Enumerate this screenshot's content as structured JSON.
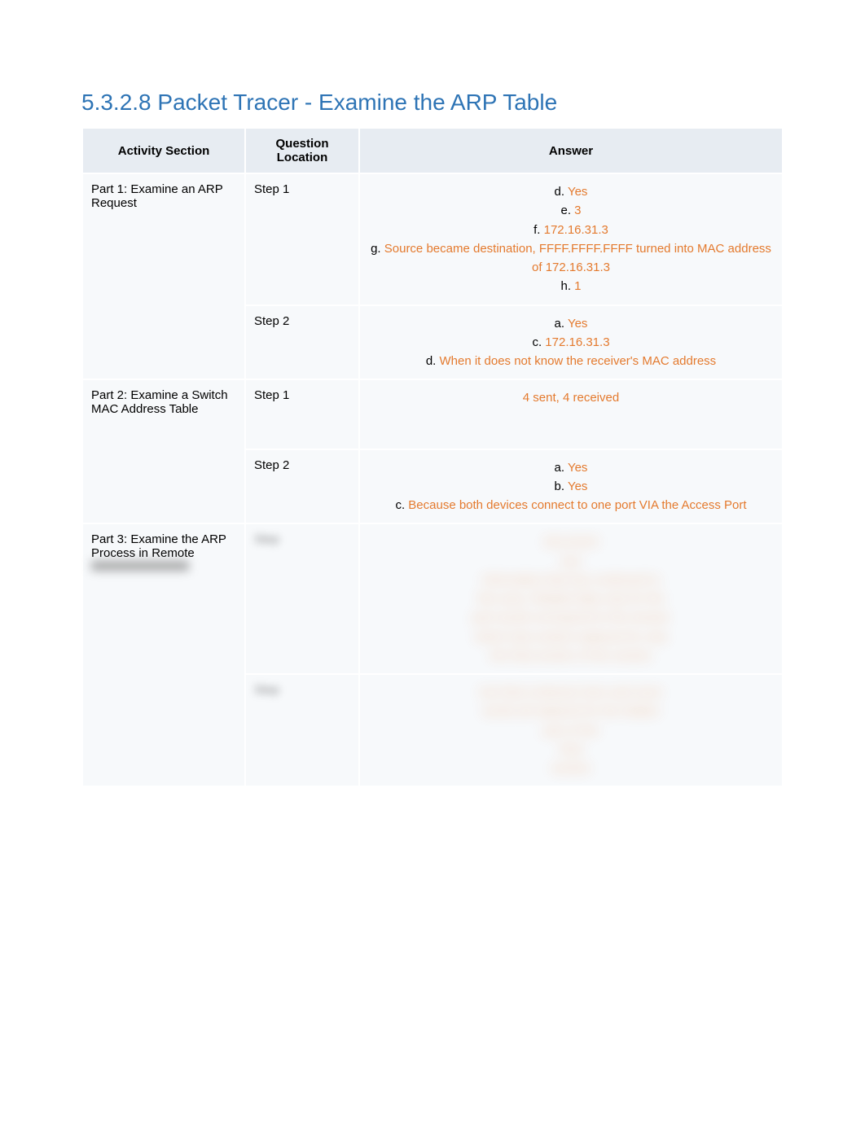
{
  "title": "5.3.2.8 Packet Tracer - Examine the ARP Table",
  "headers": {
    "activity": "Activity Section",
    "location": "Question Location",
    "answer": "Answer"
  },
  "rows": [
    {
      "activity": "Part 1: Examine an ARP Request",
      "activity_rowspan": 2,
      "location": "Step 1",
      "answers": [
        {
          "label": "d.",
          "text": "Yes"
        },
        {
          "label": "e.",
          "text": "3"
        },
        {
          "label": "f.",
          "text": "172.16.31.3"
        },
        {
          "label": "g.",
          "text": "Source became destination, FFFF.FFFF.FFFF turned into MAC address of 172.16.31.3"
        },
        {
          "label": "h.",
          "text": "1"
        }
      ]
    },
    {
      "location": "Step 2",
      "answers": [
        {
          "label": "a.",
          "text": "Yes",
          "indent": true
        },
        {
          "label": "c.",
          "text": "172.16.31.3"
        },
        {
          "label": "d.",
          "text": "When it does not know the receiver's MAC address"
        }
      ]
    },
    {
      "activity": "Part 2: Examine a Switch MAC Address Table",
      "activity_rowspan": 2,
      "location": "Step 1",
      "answers": [
        {
          "label": "",
          "text": "4 sent, 4 received"
        }
      ],
      "tall": true
    },
    {
      "location": "Step 2",
      "answers": [
        {
          "label": "a.",
          "text": "Yes",
          "indent": true
        },
        {
          "label": "b.",
          "text": "Yes",
          "indent": true
        },
        {
          "label": "c.",
          "text": "Because both devices connect to one port VIA the Access Port",
          "indent": true
        }
      ]
    },
    {
      "activity": "Part 3: Examine the ARP Process in Remote",
      "activity_rowspan": 2,
      "activity_blurred_tail": true,
      "location_blurred": true,
      "answer_blurred": true,
      "blur_height": 160
    },
    {
      "location_blurred": true,
      "answer_blurred": true,
      "blur_height": 90
    }
  ],
  "blur_placeholder_lines": [
    "document",
    "text",
    "information that has continued to",
    "this area. Related data only for the",
    "part would correspond to the answer",
    "which had content replaced for only",
    "the final section of the section"
  ],
  "blur_placeholder_lines2": [
    "text that continues here and more",
    "words all replaced for the hidden",
    "part of the",
    "final",
    "section"
  ]
}
